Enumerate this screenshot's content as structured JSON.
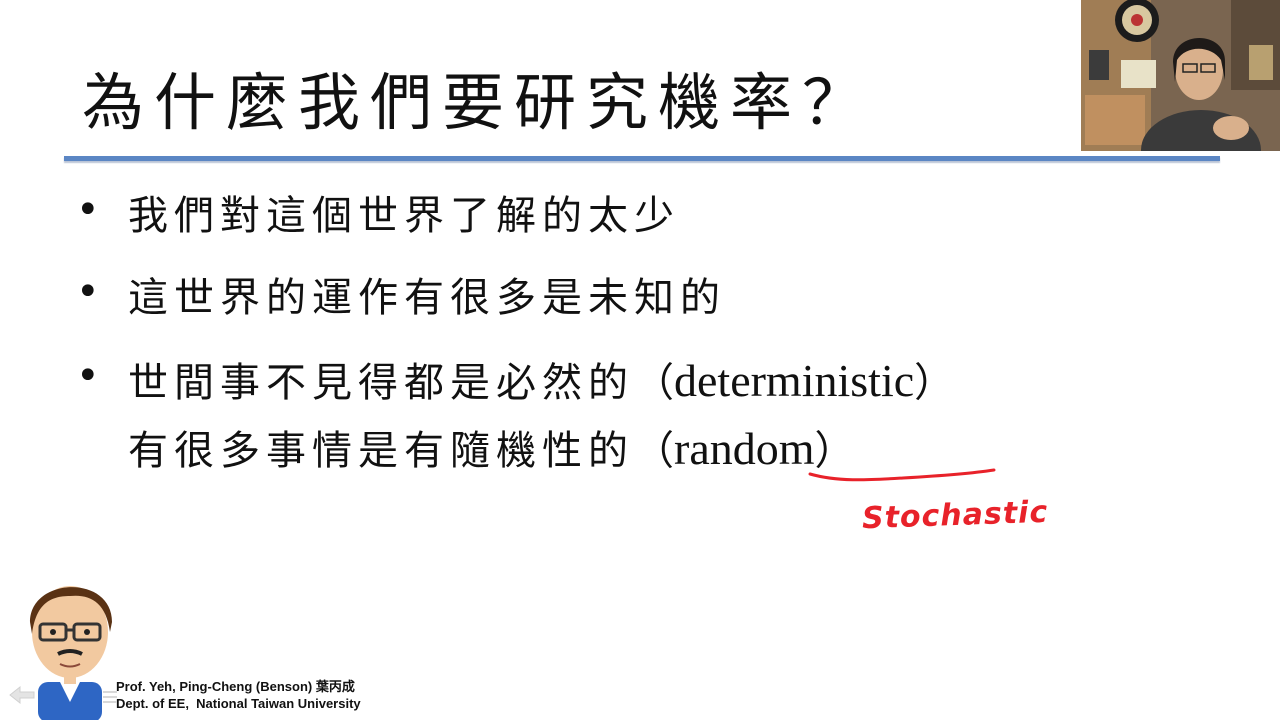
{
  "slide": {
    "title": "為什麼我們要研究機率？",
    "bullets": [
      {
        "line1": "我們對這個世界了解的太少"
      },
      {
        "line1": "這世界的運作有很多是未知的"
      },
      {
        "line1_zh": "世間事不見得都是必然的",
        "line1_open": "（",
        "line1_en": "deterministic",
        "line1_close": "）",
        "line2_zh": "有很多事情是有隨機性的",
        "line2_open": "（",
        "line2_en": "random",
        "line2_close": "）"
      }
    ],
    "bullet_glyph": "•"
  },
  "annotation": {
    "text": "Stochastic",
    "color": "#e8222a",
    "underlines": "random"
  },
  "footer": {
    "name_line": "Prof. Yeh, Ping-Cheng (Benson) 葉丙成",
    "dept_line": "Dept. of EE,  National Taiwan University"
  },
  "colors": {
    "title_rule": "#5b86c4",
    "ink_red": "#e8222a"
  },
  "icons": [
    "webcam-video",
    "presenter-avatar",
    "prev-slide-arrow-icon",
    "slide-menu-icon"
  ]
}
